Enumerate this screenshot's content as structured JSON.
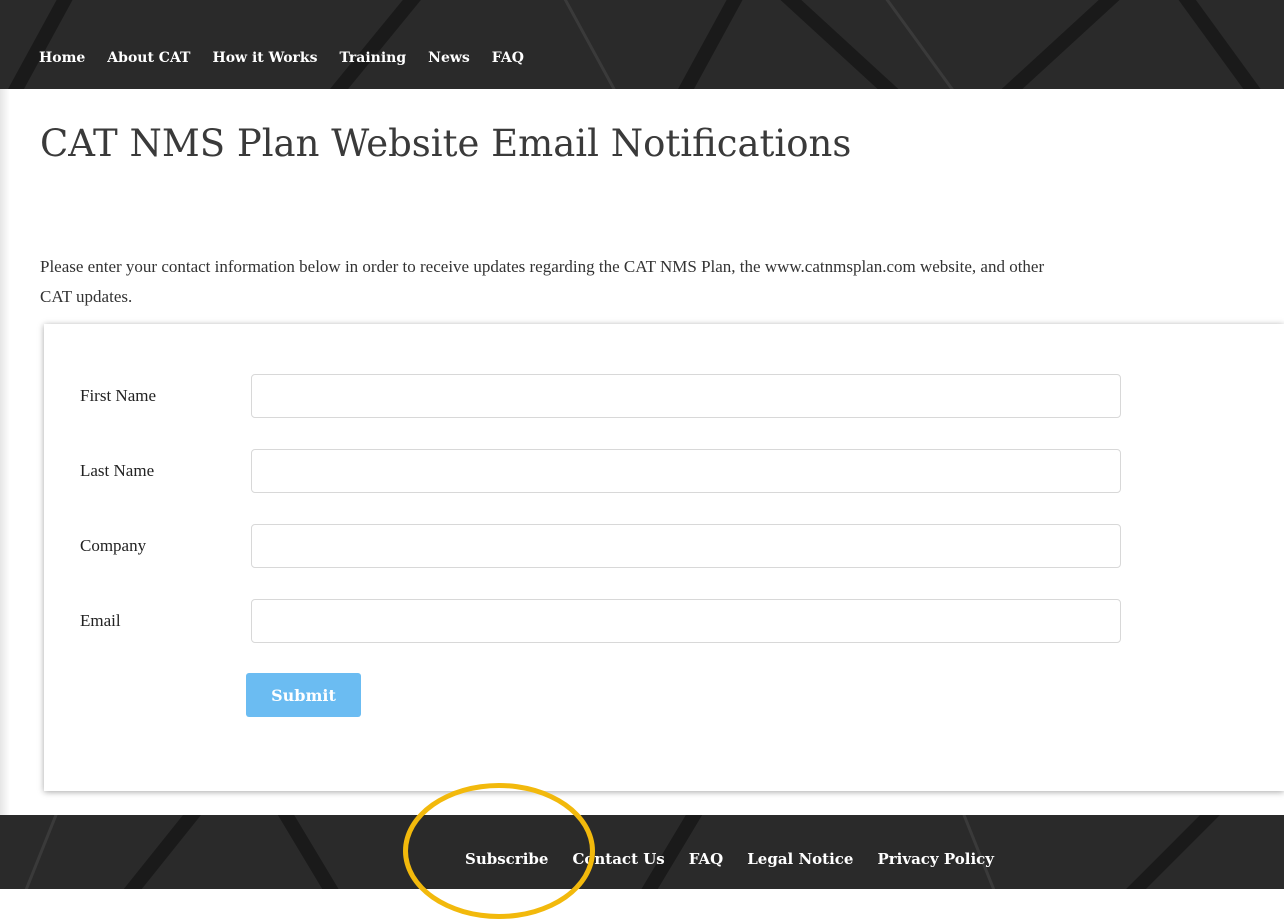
{
  "header": {
    "nav": [
      {
        "label": "Home"
      },
      {
        "label": "About CAT"
      },
      {
        "label": "How it Works"
      },
      {
        "label": "Training"
      },
      {
        "label": "News"
      },
      {
        "label": "FAQ"
      }
    ]
  },
  "main": {
    "title": "CAT NMS Plan Website Email Notifications",
    "intro": "Please enter your contact information below in order to receive updates regarding the CAT NMS Plan, the www.catnmsplan.com website, and other CAT updates."
  },
  "form": {
    "fields": [
      {
        "label": "First Name",
        "value": ""
      },
      {
        "label": "Last Name",
        "value": ""
      },
      {
        "label": "Company",
        "value": ""
      },
      {
        "label": "Email",
        "value": ""
      }
    ],
    "submit_label": "Submit"
  },
  "footer": {
    "links": [
      {
        "label": "Subscribe"
      },
      {
        "label": "Contact Us"
      },
      {
        "label": "FAQ"
      },
      {
        "label": "Legal Notice"
      },
      {
        "label": "Privacy Policy"
      }
    ]
  },
  "colors": {
    "header_bg": "#2a2a2a",
    "submit_button": "#6bbcf2",
    "highlight_circle": "#f2b90c"
  },
  "icons": {
    "annotation": "highlight-circle"
  }
}
